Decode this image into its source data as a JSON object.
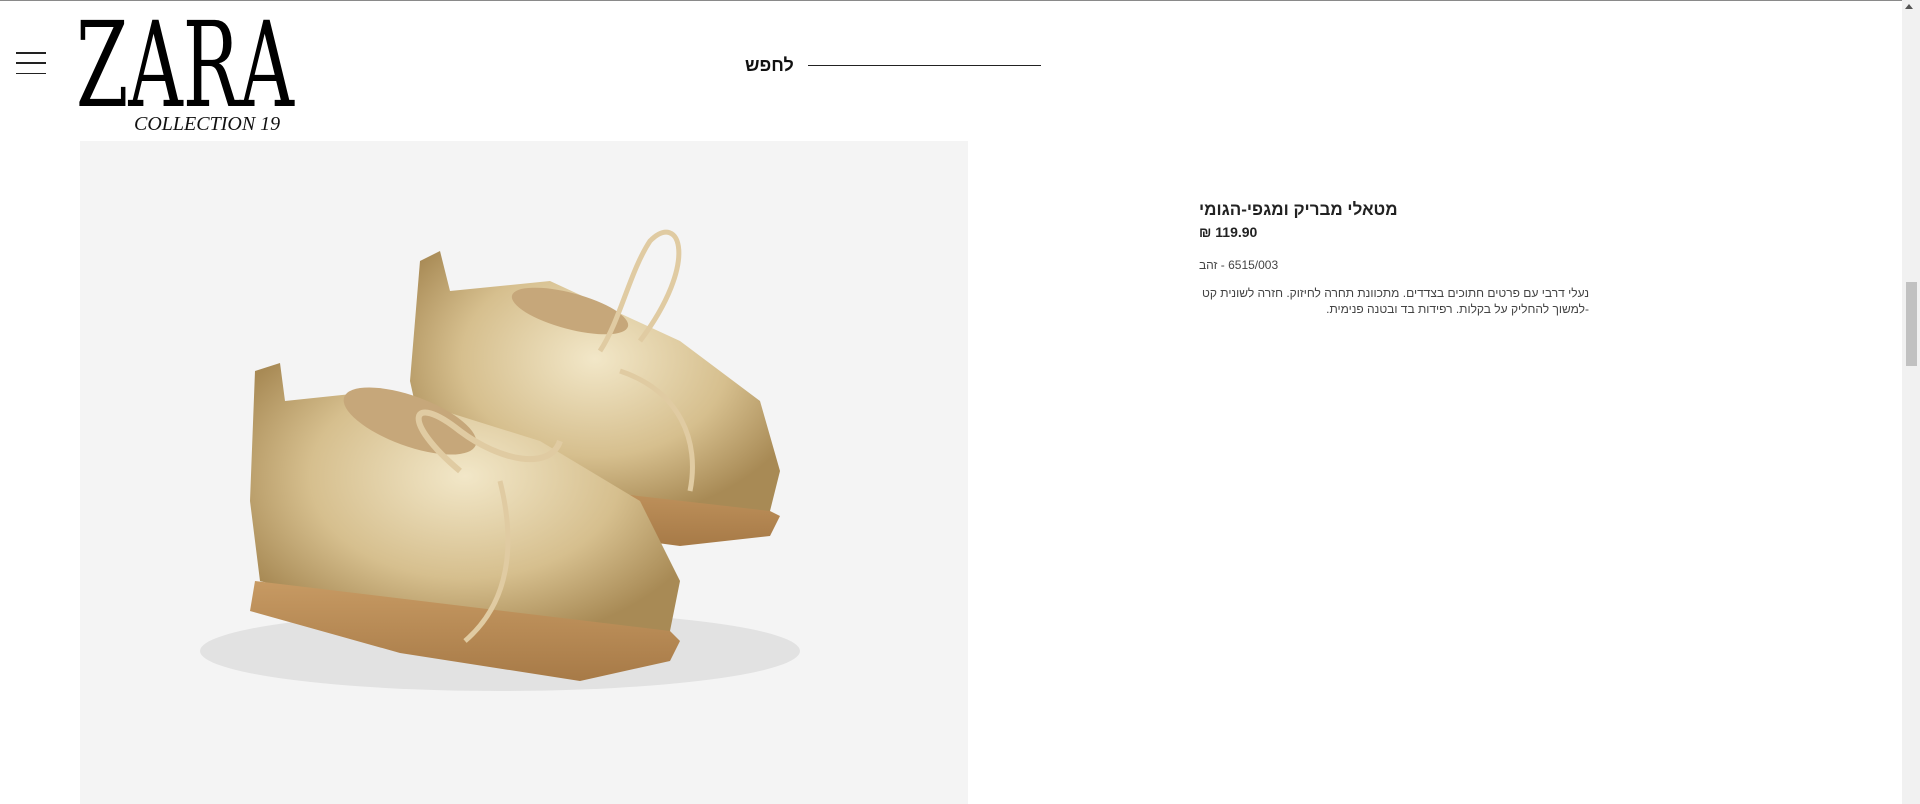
{
  "header": {
    "logo_text": "ZARA",
    "logo_sub": "COLLECTION 19",
    "menu_icon": "hamburger-icon",
    "search_label": "לחפש"
  },
  "product": {
    "title": "מטאלי מבריק ומגפי-הגומי",
    "price": "119.90 ₪",
    "reference": "6515/003 - זהב",
    "description": "נעלי דרבי עם פרטים חתוכים בצדדים. מתכוונת תחרה לחיזוק. חזרה לשונית קט -למשוך להחליק על בקלות. רפידות בד ובטנה פנימית.",
    "image_icon": "gold-derby-shoes-image"
  },
  "colors": {
    "accent": "#111111",
    "panel_bg": "#f4f4f4",
    "gold": "#d8c49a"
  }
}
